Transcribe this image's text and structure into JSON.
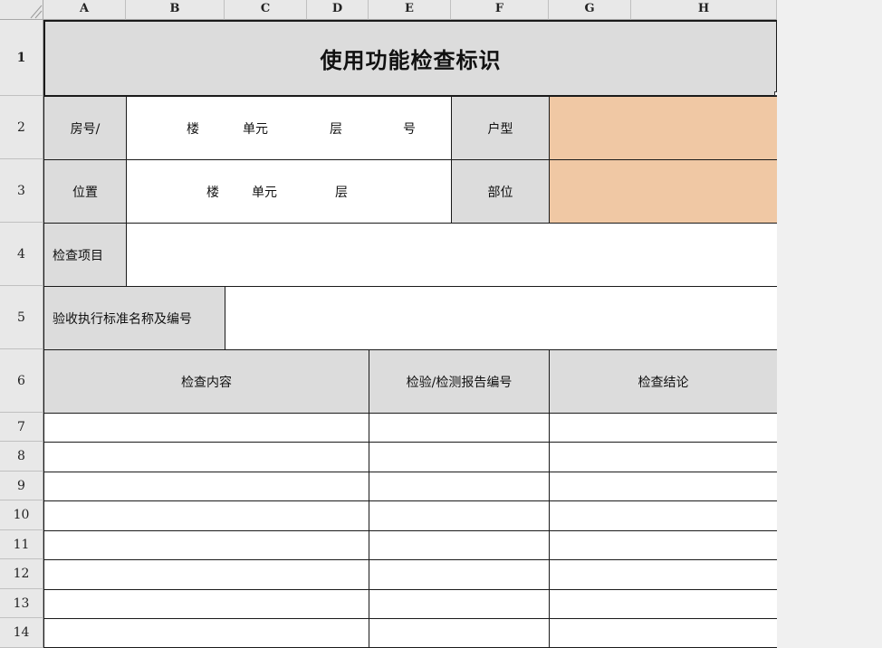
{
  "columns": [
    "A",
    "B",
    "C",
    "D",
    "E",
    "F",
    "G",
    "H"
  ],
  "rows": [
    "1",
    "2",
    "3",
    "4",
    "5",
    "6",
    "7",
    "8",
    "9",
    "10",
    "11",
    "12",
    "13",
    "14"
  ],
  "title": "使用功能检查标识",
  "row2": {
    "label": "房号/",
    "lou": "楼",
    "danyuan": "单元",
    "ceng": "层",
    "hao": "号",
    "huxing_label": "户型",
    "huxing_value": ""
  },
  "row3": {
    "label": "位置",
    "lou": "楼",
    "danyuan": "单元",
    "ceng": "层",
    "buwei_label": "部位",
    "buwei_value": ""
  },
  "row4": {
    "label": "检查项目",
    "value": ""
  },
  "row5": {
    "label": "验收执行标准名称及编号",
    "value": ""
  },
  "row6": {
    "content_header": "检查内容",
    "report_header": "检验/检测报告编号",
    "conclusion_header": "检查结论"
  },
  "colors": {
    "header_gray": "#dcdcdc",
    "highlight_peach": "#f0c8a4",
    "border": "#1a1a1a"
  }
}
